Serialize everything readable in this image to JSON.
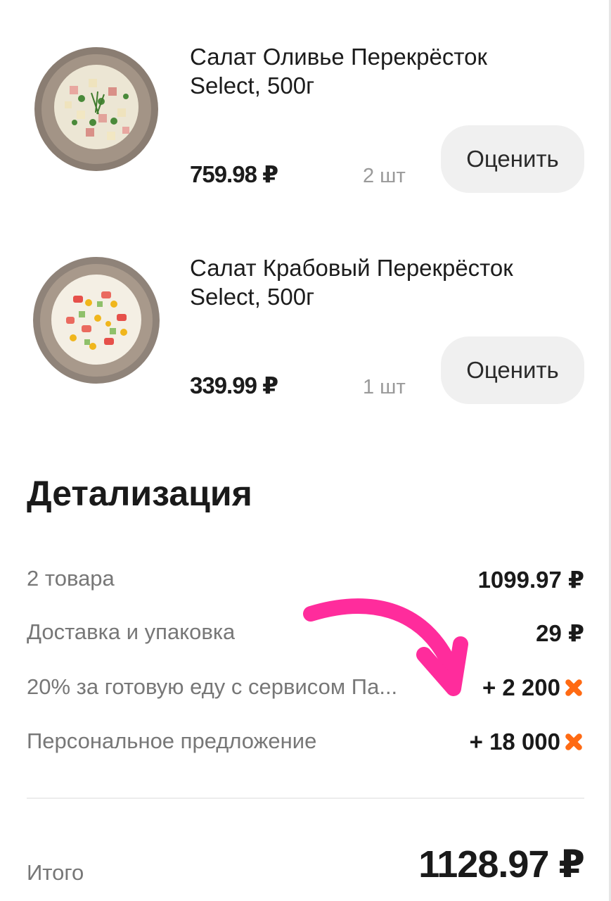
{
  "products": [
    {
      "name": "Салат Оливье Перекрёсток Select, 500г",
      "price": "759.98 ₽",
      "qty": "2 шт",
      "rate_label": "Оценить"
    },
    {
      "name": "Салат Крабовый Перекрёсток Select, 500г",
      "price": "339.99 ₽",
      "qty": "1 шт",
      "rate_label": "Оценить"
    }
  ],
  "details": {
    "title": "Детализация",
    "rows": [
      {
        "label": "2 товара",
        "value": "1099.97 ₽"
      },
      {
        "label": "Доставка и упаковка",
        "value": "29 ₽"
      },
      {
        "label": "20% за готовую еду с сервисом Па...",
        "value": "+ 2 200",
        "icon": "bonus-icon"
      },
      {
        "label": "Персональное предложение",
        "value": "+ 18 000",
        "icon": "bonus-icon"
      }
    ],
    "total_label": "Итого",
    "total_value": "1128.97 ₽"
  },
  "colors": {
    "bonus": "#ff6a13",
    "annotation_arrow": "#ff2c9c"
  }
}
